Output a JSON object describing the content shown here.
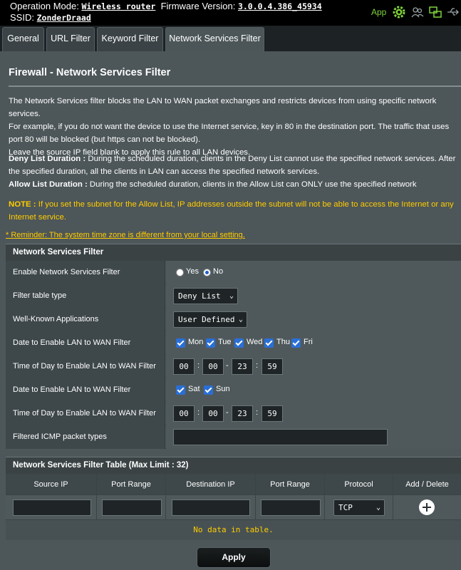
{
  "topbar": {
    "operation_mode_label": "Operation Mode:",
    "operation_mode_value": "Wireless router",
    "firmware_label": "Firmware Version:",
    "firmware_value": "3.0.0.4.386_45934",
    "ssid_label": "SSID:",
    "ssid_value": "ZonderDraad",
    "app_label": "App",
    "icons": [
      "gear-icon",
      "users-icon",
      "network-icon",
      "usb-icon"
    ],
    "accent_color": "#7fd23b"
  },
  "tabs": [
    {
      "label": "General"
    },
    {
      "label": "URL Filter"
    },
    {
      "label": "Keyword Filter"
    },
    {
      "label": "Network Services Filter",
      "active": true
    }
  ],
  "page": {
    "title": "Firewall - Network Services Filter",
    "desc1": "The Network Services filter blocks the LAN to WAN packet exchanges and restricts devices from using specific network services.",
    "desc2": "For example, if you do not want the device to use the Internet service, key in 80 in the destination port. The traffic that uses port 80 will be blocked (but https can not be blocked).",
    "desc3": "Leave the source IP field blank to apply this rule to all LAN devices.",
    "deny_label": "Deny List Duration :",
    "deny_text": " During the scheduled duration, clients in the Deny List cannot use the specified network services. After the specified duration, all the clients in LAN can access the specified network services.",
    "allow_label": "Allow List Duration :",
    "allow_text": " During the scheduled duration, clients in the Allow List can ONLY use the specified network",
    "note_label": "NOTE :",
    "note_text": " If you set the subnet for the Allow List, IP addresses outside the subnet will not be able to access the Internet or any Internet service.",
    "reminder": "* Reminder: The system time zone is different from your local setting."
  },
  "form": {
    "section_title": "Network Services Filter",
    "enable_label": "Enable Network Services Filter",
    "yes_label": "Yes",
    "no_label": "No",
    "enable_value": "No",
    "filter_type_label": "Filter table type",
    "filter_type_value": "Deny List",
    "well_known_label": "Well-Known Applications",
    "well_known_value": "User Defined",
    "date1_label": "Date to Enable LAN to WAN Filter",
    "weekdays": [
      "Mon",
      "Tue",
      "Wed",
      "Thu",
      "Fri"
    ],
    "time1_label": "Time of Day to Enable LAN to WAN Filter",
    "time1": {
      "start_h": "00",
      "start_m": "00",
      "end_h": "23",
      "end_m": "59"
    },
    "date2_label": "Date to Enable LAN to WAN Filter",
    "weekend": [
      "Sat",
      "Sun"
    ],
    "time2_label": "Time of Day to Enable LAN to WAN Filter",
    "time2": {
      "start_h": "00",
      "start_m": "00",
      "end_h": "23",
      "end_m": "59"
    },
    "icmp_label": "Filtered ICMP packet types",
    "icmp_value": ""
  },
  "rules": {
    "title": "Network Services Filter Table (Max Limit : 32)",
    "columns": [
      "Source IP",
      "Port Range",
      "Destination IP",
      "Port Range",
      "Protocol",
      "Add / Delete"
    ],
    "protocol_value": "TCP",
    "no_data": "No data in table."
  },
  "apply_label": "Apply"
}
